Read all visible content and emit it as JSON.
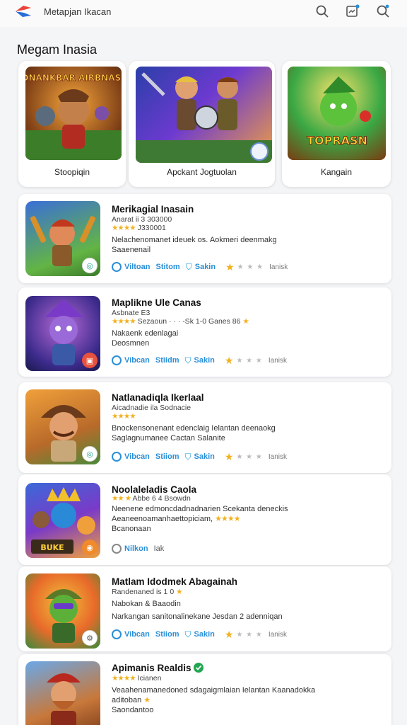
{
  "header": {
    "app_title": "Metapjan Ikacan",
    "icons": [
      "logo-icon",
      "search-icon",
      "message-icon",
      "search-icon"
    ]
  },
  "section": {
    "title": "Megam Inasia"
  },
  "featured": [
    {
      "label": "Stoopiqin",
      "art_title": "TDNANKBAR AIRBNASIN"
    },
    {
      "label": "Apckant Jogtuolan",
      "art_title": ""
    },
    {
      "label": "Kangain",
      "art_title": "TOPRASN"
    }
  ],
  "games": [
    {
      "name": "Merikagial Inasain",
      "meta": "Anarat ii 3 303000",
      "rating_text": "J330001",
      "desc_lines": [
        "Nelachenomanet ideuek os. Aokmeri deenmakg",
        "Saaenenail"
      ],
      "actions": {
        "a": "Viltoan",
        "b": "Stitom",
        "c": "Sakin",
        "tail": "Ianisk"
      }
    },
    {
      "name": "Maplikne Ule Canas",
      "meta": "Asbnate E3",
      "rating_text": "Sezaoun · · · -Sk 1-0 Ganes 86",
      "desc_lines": [
        "Nakaenk edenlagai",
        "Deosmnen"
      ],
      "actions": {
        "a": "Vibcan",
        "b": "Stiidm",
        "c": "Sakin",
        "tail": "Ianisk"
      }
    },
    {
      "name": "Natlanadiqla Ikerlaal",
      "meta": "Aicadnadie ila Sodnacie",
      "rating_text": "",
      "desc_lines": [
        "Bnockensonenant edenclaig Ielantan deenaokg",
        "Saglagnumanee Cactan Salanite"
      ],
      "actions": {
        "a": "Vibcan",
        "b": "Stiiom",
        "c": "Sakin",
        "tail": "Ianisk"
      }
    },
    {
      "name": "Noolaleladis Caola",
      "meta": "Abbe 6 4 Bsowdn",
      "rating_text": "",
      "desc_lines": [
        "Neenene edmoncdadnadnarien Scekanta deneckis",
        "Aeaneenoamanhaettopiciam,"
      ],
      "extra_line": "Bcanonaan",
      "actions": {
        "a": "Nilkon",
        "b": "Iak",
        "c": "",
        "tail": ""
      }
    },
    {
      "name": "Matlam Idodmek Abagainah",
      "meta": "Randenaned is 1 0",
      "rating_text": "",
      "desc_lines": [
        "Nabokan & Baaodin",
        "Narkangan sanitonalinekane Jesdan 2 adenniqan"
      ],
      "actions": {
        "a": "Vibcan",
        "b": "Stiiom",
        "c": "Sakin",
        "tail": "Ianisk"
      }
    },
    {
      "name": "Apimanis Realdis",
      "meta": "Icianen",
      "rating_text": "",
      "desc_lines": [
        "Veaahenamanedoned sdagaigmlaian Ielantan Kaanadokka",
        "aditoban"
      ],
      "extra_line": "Saondantoo",
      "actions": {
        "a": "",
        "b": "",
        "c": "",
        "tail": ""
      }
    }
  ],
  "colors": {
    "accent": "#2a8fd8",
    "star": "#f2b01e",
    "verified": "#22a651"
  }
}
